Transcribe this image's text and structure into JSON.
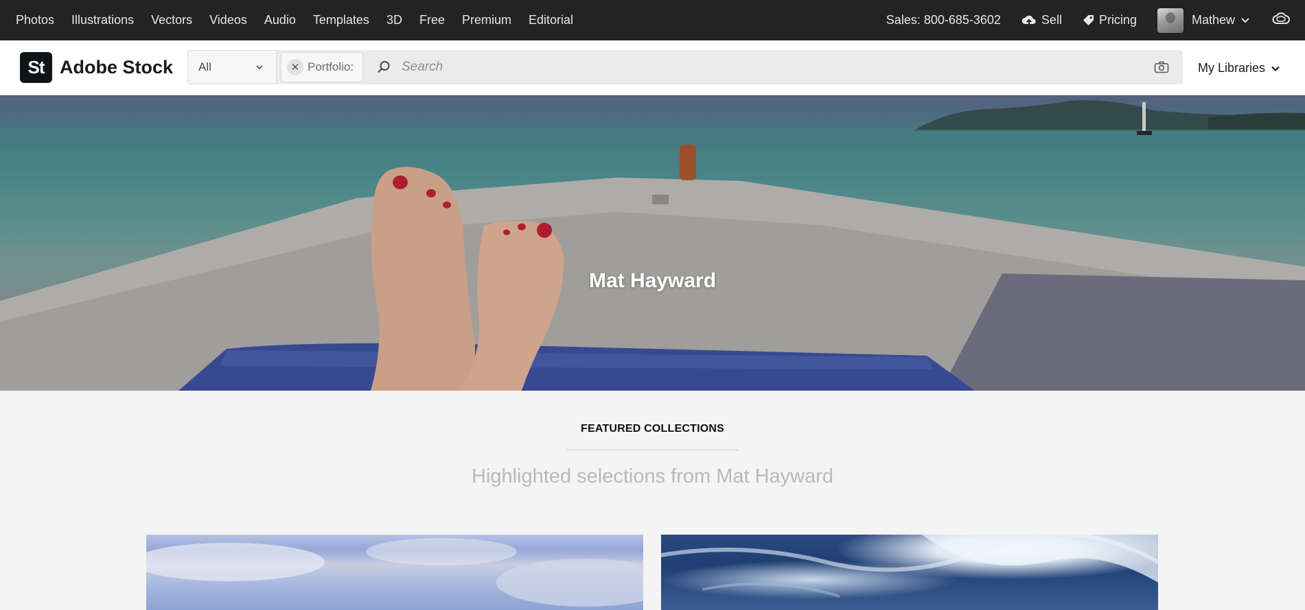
{
  "topnav": {
    "links": [
      "Photos",
      "Illustrations",
      "Vectors",
      "Videos",
      "Audio",
      "Templates",
      "3D",
      "Free",
      "Premium",
      "Editorial"
    ],
    "sales": "Sales: 800-685-3602",
    "sell": "Sell",
    "pricing": "Pricing",
    "user_name": "Mathew",
    "icons": {
      "sell": "cloud-upload-icon",
      "pricing": "price-tag-icon",
      "creative_cloud": "creative-cloud-icon"
    }
  },
  "header": {
    "logo_badge": "St",
    "logo_name": "Adobe Stock",
    "type_select": "All",
    "filter_chip": "Portfolio:",
    "search_placeholder": "Search",
    "my_libraries": "My Libraries"
  },
  "hero": {
    "title": "Mat Hayward"
  },
  "featured": {
    "label": "FEATURED COLLECTIONS",
    "subtitle": "Highlighted selections from Mat Hayward"
  },
  "colors": {
    "topnav_bg": "#232323",
    "page_bg": "#f4f4f4",
    "logo_bg": "#0f1417"
  }
}
